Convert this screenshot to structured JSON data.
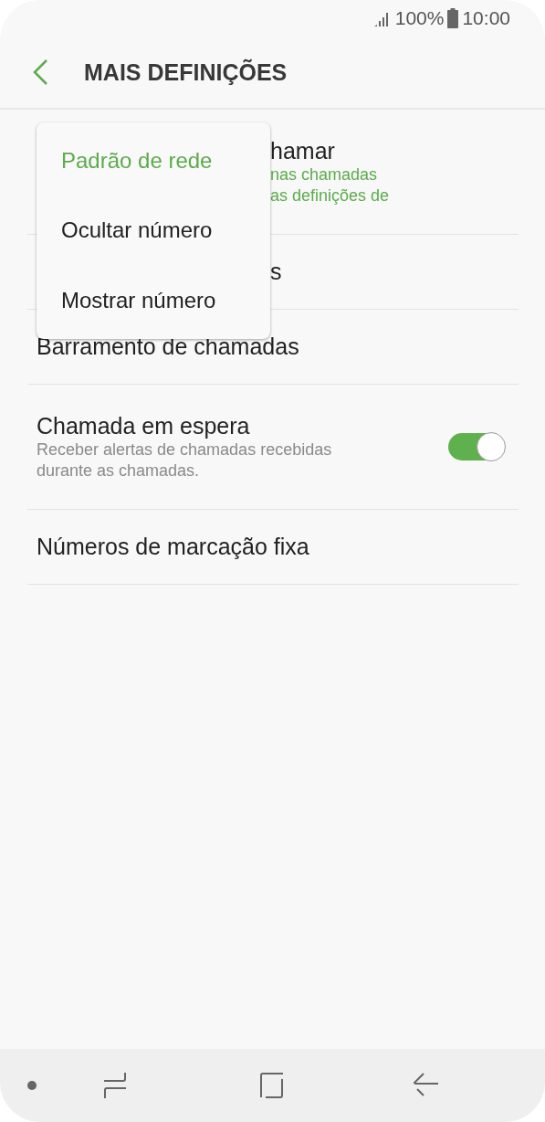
{
  "status_bar": {
    "battery": "100%",
    "time": "10:00"
  },
  "header": {
    "title": "MAIS DEFINIÇÕES"
  },
  "settings": [
    {
      "kind": "covered",
      "title": "hamar",
      "subtitle": [
        "nas chamadas",
        "as definições de"
      ]
    },
    {
      "kind": "covered",
      "title": "s"
    },
    {
      "kind": "plain",
      "title": "Barramento de chamadas"
    },
    {
      "kind": "switch",
      "title": "Chamada em espera",
      "subtitle": [
        "Receber alertas de chamadas recebidas",
        "durante as chamadas."
      ],
      "on": true
    },
    {
      "kind": "plain",
      "title": "Números de marcação fixa"
    }
  ],
  "popup_menu": [
    {
      "label": "Padrão de rede",
      "selected": true
    },
    {
      "label": "Ocultar número",
      "selected": false
    },
    {
      "label": "Mostrar número",
      "selected": false
    }
  ]
}
